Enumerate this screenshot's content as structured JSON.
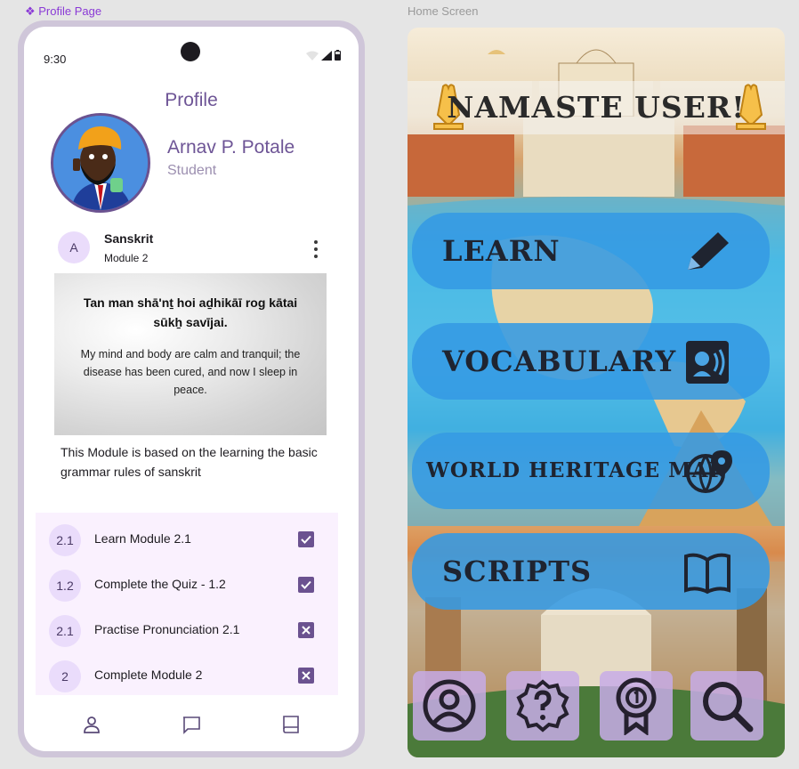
{
  "frames": {
    "profile_label": "❖ Profile Page",
    "home_label": "Home Screen"
  },
  "profile": {
    "status_time": "9:30",
    "title": "Profile",
    "name": "Arnav P. Potale",
    "role": "Student",
    "course": {
      "badge": "A",
      "name": "Sanskrit",
      "module": "Module 2"
    },
    "quote": {
      "original": "Tan man shā'nṯ hoi aḏhikāī rog kātai sūkẖ savījai.",
      "translation": "My mind and body are calm and tranquil; the disease has been cured, and now I sleep in peace."
    },
    "description": "This Module is based on the learning the basic grammar rules of sanskrit",
    "tasks": [
      {
        "num": "2.1",
        "label": "Learn Module 2.1",
        "done": true
      },
      {
        "num": "1.2",
        "label": "Complete the Quiz - 1.2",
        "done": true
      },
      {
        "num": "2.1",
        "label": "Practise Pronunciation 2.1",
        "done": false
      },
      {
        "num": "2",
        "label": "Complete Module 2",
        "done": false
      }
    ],
    "nav": [
      "profile-icon",
      "chat-icon",
      "book-icon"
    ],
    "colors": {
      "accent": "#6e5596",
      "badge_bg": "#eadcfb",
      "tasks_bg": "#faf1fe"
    }
  },
  "home": {
    "greeting": "NAMASTE USER!",
    "menu": [
      {
        "label": "LEARN",
        "icon": "pencil-icon"
      },
      {
        "label": "VOCABULARY",
        "icon": "speaking-icon"
      },
      {
        "label": "WORLD HERITAGE MAP",
        "icon": "globe-pin-icon"
      },
      {
        "label": "SCRIPTS",
        "icon": "open-book-icon"
      }
    ],
    "footer": [
      "profile-icon",
      "help-icon",
      "award-icon",
      "search-icon"
    ],
    "colors": {
      "button": "#349ae4",
      "footer_button": "#c7ace8"
    }
  }
}
